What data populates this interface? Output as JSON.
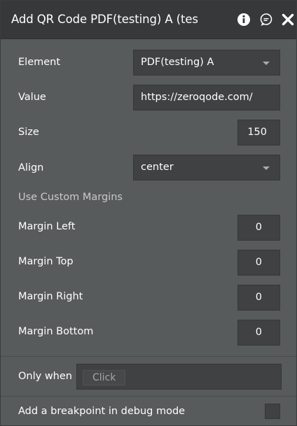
{
  "window": {
    "title": "Add QR Code PDF(testing) A (tes"
  },
  "header_icons": [
    "info-icon",
    "comment-icon",
    "close-icon"
  ],
  "fields": {
    "element": {
      "label": "Element",
      "value": "PDF(testing) A"
    },
    "value": {
      "label": "Value",
      "value": "https://zeroqode.com/"
    },
    "size": {
      "label": "Size",
      "value": "150"
    },
    "align": {
      "label": "Align",
      "value": "center"
    },
    "margins_section": "Use Custom Margins",
    "margin_left": {
      "label": "Margin Left",
      "value": "0"
    },
    "margin_top": {
      "label": "Margin Top",
      "value": "0"
    },
    "margin_right": {
      "label": "Margin Right",
      "value": "0"
    },
    "margin_bottom": {
      "label": "Margin Bottom",
      "value": "0"
    }
  },
  "conditions": {
    "only_when": {
      "label": "Only when",
      "button": "Click"
    },
    "breakpoint": {
      "label": "Add a breakpoint in debug mode",
      "checked": false
    }
  },
  "colors": {
    "panel_bg": "#585b5c",
    "header_bg": "#363839",
    "field_bg": "#3f4142",
    "text": "#ffffff"
  }
}
